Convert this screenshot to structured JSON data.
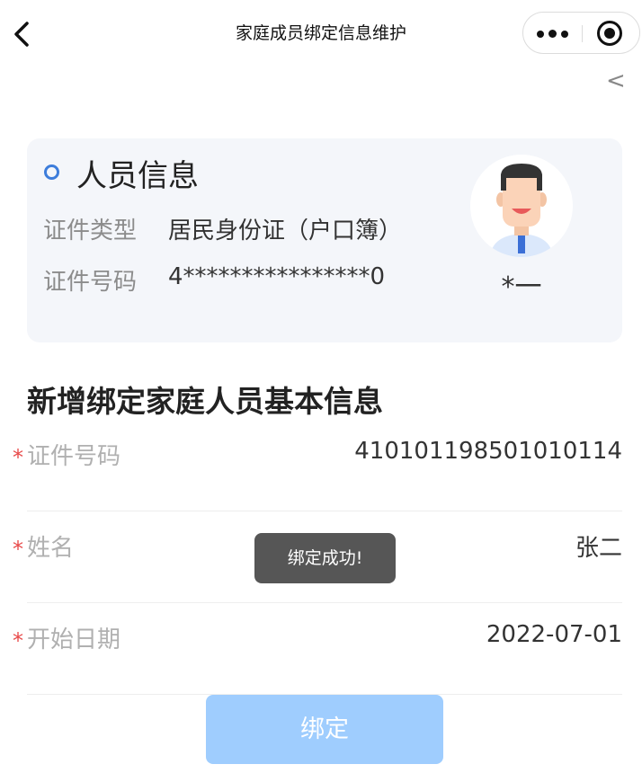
{
  "navbar": {
    "title": "家庭成员绑定信息维护",
    "back_icon": "chevron-left-icon",
    "more_icon": "more-dots-icon",
    "close_icon": "target-circle-icon"
  },
  "collapse_chevron": "<",
  "person_card": {
    "title": "人员信息",
    "id_type_label": "证件类型",
    "id_type_value": "居民身份证（户口簿）",
    "id_no_label": "证件号码",
    "id_no_value": "4****************0",
    "name": "*一",
    "accent_color": "#3d7ddb"
  },
  "section_title": "新增绑定家庭人员基本信息",
  "form": {
    "required_mark": "*",
    "fields": [
      {
        "label": "证件号码",
        "value": "410101198501010114"
      },
      {
        "label": "姓名",
        "value": "张二"
      },
      {
        "label": "开始日期",
        "value": "2022-07-01"
      }
    ]
  },
  "toast": "绑定成功!",
  "bind_button": {
    "label": "绑定",
    "color": "#9fcdfe"
  }
}
